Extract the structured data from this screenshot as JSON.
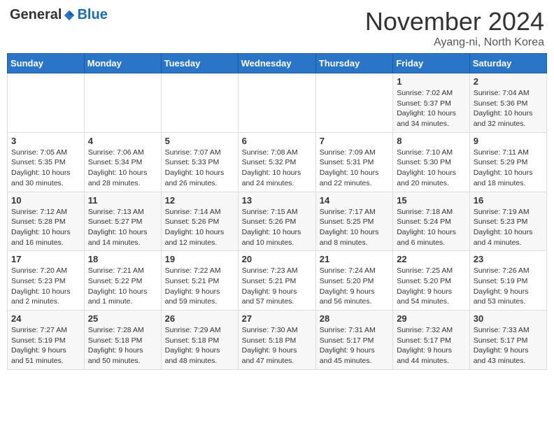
{
  "header": {
    "logo_general": "General",
    "logo_blue": "Blue",
    "month": "November 2024",
    "location": "Ayang-ni, North Korea"
  },
  "weekdays": [
    "Sunday",
    "Monday",
    "Tuesday",
    "Wednesday",
    "Thursday",
    "Friday",
    "Saturday"
  ],
  "weeks": [
    [
      {
        "day": "",
        "info": ""
      },
      {
        "day": "",
        "info": ""
      },
      {
        "day": "",
        "info": ""
      },
      {
        "day": "",
        "info": ""
      },
      {
        "day": "",
        "info": ""
      },
      {
        "day": "1",
        "info": "Sunrise: 7:02 AM\nSunset: 5:37 PM\nDaylight: 10 hours\nand 34 minutes."
      },
      {
        "day": "2",
        "info": "Sunrise: 7:04 AM\nSunset: 5:36 PM\nDaylight: 10 hours\nand 32 minutes."
      }
    ],
    [
      {
        "day": "3",
        "info": "Sunrise: 7:05 AM\nSunset: 5:35 PM\nDaylight: 10 hours\nand 30 minutes."
      },
      {
        "day": "4",
        "info": "Sunrise: 7:06 AM\nSunset: 5:34 PM\nDaylight: 10 hours\nand 28 minutes."
      },
      {
        "day": "5",
        "info": "Sunrise: 7:07 AM\nSunset: 5:33 PM\nDaylight: 10 hours\nand 26 minutes."
      },
      {
        "day": "6",
        "info": "Sunrise: 7:08 AM\nSunset: 5:32 PM\nDaylight: 10 hours\nand 24 minutes."
      },
      {
        "day": "7",
        "info": "Sunrise: 7:09 AM\nSunset: 5:31 PM\nDaylight: 10 hours\nand 22 minutes."
      },
      {
        "day": "8",
        "info": "Sunrise: 7:10 AM\nSunset: 5:30 PM\nDaylight: 10 hours\nand 20 minutes."
      },
      {
        "day": "9",
        "info": "Sunrise: 7:11 AM\nSunset: 5:29 PM\nDaylight: 10 hours\nand 18 minutes."
      }
    ],
    [
      {
        "day": "10",
        "info": "Sunrise: 7:12 AM\nSunset: 5:28 PM\nDaylight: 10 hours\nand 16 minutes."
      },
      {
        "day": "11",
        "info": "Sunrise: 7:13 AM\nSunset: 5:27 PM\nDaylight: 10 hours\nand 14 minutes."
      },
      {
        "day": "12",
        "info": "Sunrise: 7:14 AM\nSunset: 5:26 PM\nDaylight: 10 hours\nand 12 minutes."
      },
      {
        "day": "13",
        "info": "Sunrise: 7:15 AM\nSunset: 5:26 PM\nDaylight: 10 hours\nand 10 minutes."
      },
      {
        "day": "14",
        "info": "Sunrise: 7:17 AM\nSunset: 5:25 PM\nDaylight: 10 hours\nand 8 minutes."
      },
      {
        "day": "15",
        "info": "Sunrise: 7:18 AM\nSunset: 5:24 PM\nDaylight: 10 hours\nand 6 minutes."
      },
      {
        "day": "16",
        "info": "Sunrise: 7:19 AM\nSunset: 5:23 PM\nDaylight: 10 hours\nand 4 minutes."
      }
    ],
    [
      {
        "day": "17",
        "info": "Sunrise: 7:20 AM\nSunset: 5:23 PM\nDaylight: 10 hours\nand 2 minutes."
      },
      {
        "day": "18",
        "info": "Sunrise: 7:21 AM\nSunset: 5:22 PM\nDaylight: 10 hours\nand 1 minute."
      },
      {
        "day": "19",
        "info": "Sunrise: 7:22 AM\nSunset: 5:21 PM\nDaylight: 9 hours\nand 59 minutes."
      },
      {
        "day": "20",
        "info": "Sunrise: 7:23 AM\nSunset: 5:21 PM\nDaylight: 9 hours\nand 57 minutes."
      },
      {
        "day": "21",
        "info": "Sunrise: 7:24 AM\nSunset: 5:20 PM\nDaylight: 9 hours\nand 56 minutes."
      },
      {
        "day": "22",
        "info": "Sunrise: 7:25 AM\nSunset: 5:20 PM\nDaylight: 9 hours\nand 54 minutes."
      },
      {
        "day": "23",
        "info": "Sunrise: 7:26 AM\nSunset: 5:19 PM\nDaylight: 9 hours\nand 53 minutes."
      }
    ],
    [
      {
        "day": "24",
        "info": "Sunrise: 7:27 AM\nSunset: 5:19 PM\nDaylight: 9 hours\nand 51 minutes."
      },
      {
        "day": "25",
        "info": "Sunrise: 7:28 AM\nSunset: 5:18 PM\nDaylight: 9 hours\nand 50 minutes."
      },
      {
        "day": "26",
        "info": "Sunrise: 7:29 AM\nSunset: 5:18 PM\nDaylight: 9 hours\nand 48 minutes."
      },
      {
        "day": "27",
        "info": "Sunrise: 7:30 AM\nSunset: 5:18 PM\nDaylight: 9 hours\nand 47 minutes."
      },
      {
        "day": "28",
        "info": "Sunrise: 7:31 AM\nSunset: 5:17 PM\nDaylight: 9 hours\nand 45 minutes."
      },
      {
        "day": "29",
        "info": "Sunrise: 7:32 AM\nSunset: 5:17 PM\nDaylight: 9 hours\nand 44 minutes."
      },
      {
        "day": "30",
        "info": "Sunrise: 7:33 AM\nSunset: 5:17 PM\nDaylight: 9 hours\nand 43 minutes."
      }
    ]
  ]
}
